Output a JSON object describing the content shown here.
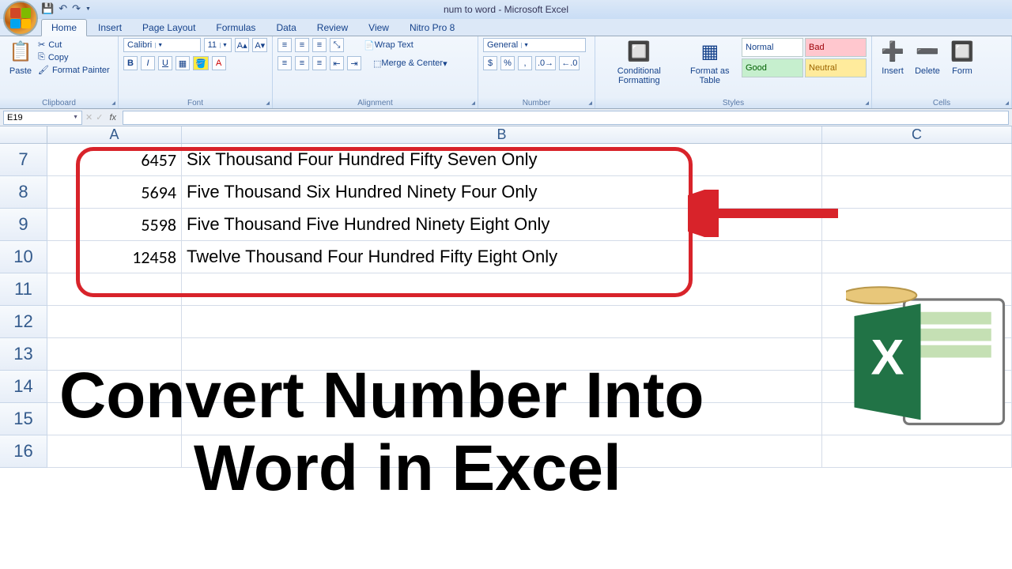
{
  "window_title": "num to word - Microsoft Excel",
  "qat": {
    "save": "💾",
    "undo": "↶",
    "redo": "↷"
  },
  "tabs": [
    "Home",
    "Insert",
    "Page Layout",
    "Formulas",
    "Data",
    "Review",
    "View",
    "Nitro Pro 8"
  ],
  "active_tab": "Home",
  "ribbon": {
    "clipboard": {
      "paste": "Paste",
      "cut": "Cut",
      "copy": "Copy",
      "painter": "Format Painter",
      "label": "Clipboard"
    },
    "font": {
      "name": "Calibri",
      "size": "11",
      "bold": "B",
      "italic": "I",
      "underline": "U",
      "label": "Font"
    },
    "alignment": {
      "wrap": "Wrap Text",
      "merge": "Merge & Center",
      "label": "Alignment"
    },
    "number": {
      "format": "General",
      "label": "Number"
    },
    "styles": {
      "cond": "Conditional Formatting",
      "table": "Format as Table",
      "normal": "Normal",
      "bad": "Bad",
      "good": "Good",
      "neutral": "Neutral",
      "label": "Styles"
    },
    "cells": {
      "insert": "Insert",
      "delete": "Delete",
      "format": "Form",
      "label": "Cells"
    }
  },
  "formula_bar": {
    "cell_ref": "E19",
    "fx": "fx",
    "formula": ""
  },
  "columns": [
    "A",
    "B",
    "C"
  ],
  "rows": [
    {
      "n": 7,
      "A": "6457",
      "B": "Six Thousand Four Hundred Fifty Seven Only"
    },
    {
      "n": 8,
      "A": "5694",
      "B": "Five Thousand Six Hundred Ninety Four Only"
    },
    {
      "n": 9,
      "A": "5598",
      "B": "Five Thousand Five Hundred Ninety Eight Only"
    },
    {
      "n": 10,
      "A": "12458",
      "B": "Twelve Thousand Four Hundred Fifty Eight Only"
    },
    {
      "n": 11,
      "A": "",
      "B": ""
    },
    {
      "n": 12,
      "A": "",
      "B": ""
    },
    {
      "n": 13,
      "A": "",
      "B": ""
    },
    {
      "n": 14,
      "A": "",
      "B": ""
    },
    {
      "n": 15,
      "A": "",
      "B": ""
    },
    {
      "n": 16,
      "A": "",
      "B": ""
    }
  ],
  "overlay": {
    "line1": "Convert Number Into",
    "line2": "Word in Excel"
  }
}
